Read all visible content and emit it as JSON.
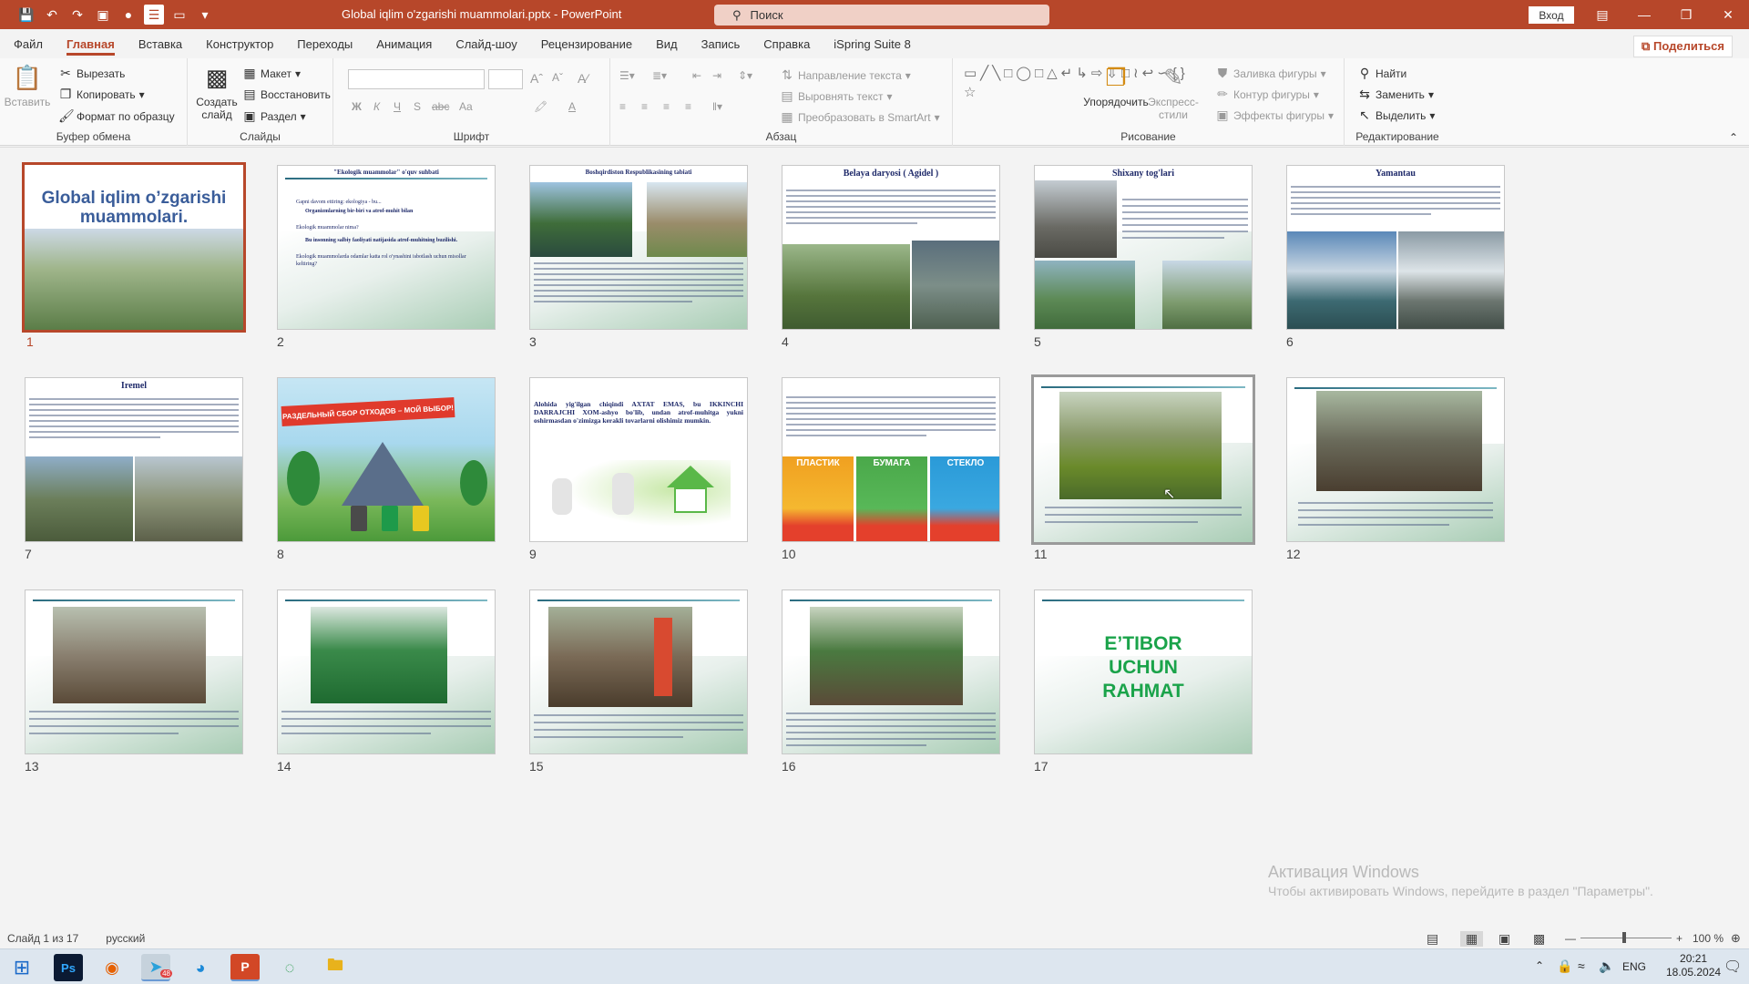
{
  "window": {
    "doc_title": "Global iqlim o'zgarishi muammolari.pptx  -  PowerPoint",
    "search_label": "Поиск",
    "signin_label": "Вход"
  },
  "tabs": [
    "Файл",
    "Главная",
    "Вставка",
    "Конструктор",
    "Переходы",
    "Анимация",
    "Слайд-шоу",
    "Рецензирование",
    "Вид",
    "Запись",
    "Справка",
    "iSpring Suite 8"
  ],
  "share_label": "Поделиться",
  "ribbon": {
    "clipboard": {
      "label": "Буфер обмена",
      "paste": "Вставить",
      "cut": "Вырезать",
      "copy": "Копировать",
      "format_painter": "Формат по образцу"
    },
    "slides": {
      "label": "Слайды",
      "new_slide": "Создать слайд",
      "layout": "Макет",
      "reset": "Восстановить",
      "section": "Раздел"
    },
    "font": {
      "label": "Шрифт",
      "bold": "Ж",
      "italic": "К",
      "underline": "Ч",
      "shadow": "S",
      "strike": "abc",
      "case": "Aa"
    },
    "paragraph": {
      "label": "Абзац",
      "text_direction": "Направление текста",
      "align_text": "Выровнять текст",
      "smartart": "Преобразовать в SmartArt"
    },
    "drawing": {
      "label": "Рисование",
      "arrange": "Упорядочить",
      "quick_styles": "Экспресс-стили",
      "fill": "Заливка фигуры",
      "outline": "Контур фигуры",
      "effects": "Эффекты фигуры"
    },
    "editing": {
      "label": "Редактирование",
      "find": "Найти",
      "replace": "Заменить",
      "select": "Выделить"
    }
  },
  "slides": [
    {
      "n": "1",
      "title": "Global iqlim o’zgarishi muammolari."
    },
    {
      "n": "2",
      "title": "\"Ekologik muammolar\" o'quv suhbati",
      "bullets": [
        "Gapni davom ettiring: ekologiya - bu...",
        "Organizmlarning bir-biri va atrof-muhit bilan",
        "Ekologik muammolar nima?",
        "Bu insonning salbiy faoliyati natijasida atrof-muhitning buzilishi.",
        "Ekologik muammolarda odamlar katta rol o'ynashini isbotlash uchun misollar keltiring?"
      ]
    },
    {
      "n": "3",
      "title": "Boshqirdiston Respublikasining tabiati"
    },
    {
      "n": "4",
      "title": "Belaya daryosi ( Agidel )"
    },
    {
      "n": "5",
      "title": "Shixany tog'lari"
    },
    {
      "n": "6",
      "title": "Yamantau"
    },
    {
      "n": "7",
      "title": "Iremel"
    },
    {
      "n": "8",
      "title": "РАЗДЕЛЬНЫЙ СБОР ОТХОДОВ – МОЙ ВЫБОР!"
    },
    {
      "n": "9",
      "title": "Alohida yig'ilgan chiqindi AXTAT EMAS, bu IKKINCHI DARRAJCHI XOM-ashyo bo'lib, undan atrof-muhitga yukni oshirmasdan o'zimizga kerakli tovarlarni olishimiz mumkin."
    },
    {
      "n": "10",
      "labels": [
        "ПЛАСТИК",
        "БУМАГА",
        "СТЕКЛО"
      ]
    },
    {
      "n": "11"
    },
    {
      "n": "12"
    },
    {
      "n": "13"
    },
    {
      "n": "14"
    },
    {
      "n": "15"
    },
    {
      "n": "16"
    },
    {
      "n": "17",
      "title": "E’TIBOR UCHUN RAHMAT"
    }
  ],
  "status": {
    "slide_of": "Слайд 1 из 17",
    "language": "русский",
    "zoom": "100 %"
  },
  "activation": {
    "title": "Активация Windows",
    "subtitle": "Чтобы активировать Windows, перейдите в раздел \"Параметры\"."
  },
  "tray": {
    "lang": "ENG",
    "time": "20:21",
    "date": "18.05.2024",
    "telegram_badge": "48"
  },
  "colors": {
    "accent": "#b7472a",
    "slide_title": "#1f2a6a",
    "thanks_green": "#1aa34a"
  }
}
